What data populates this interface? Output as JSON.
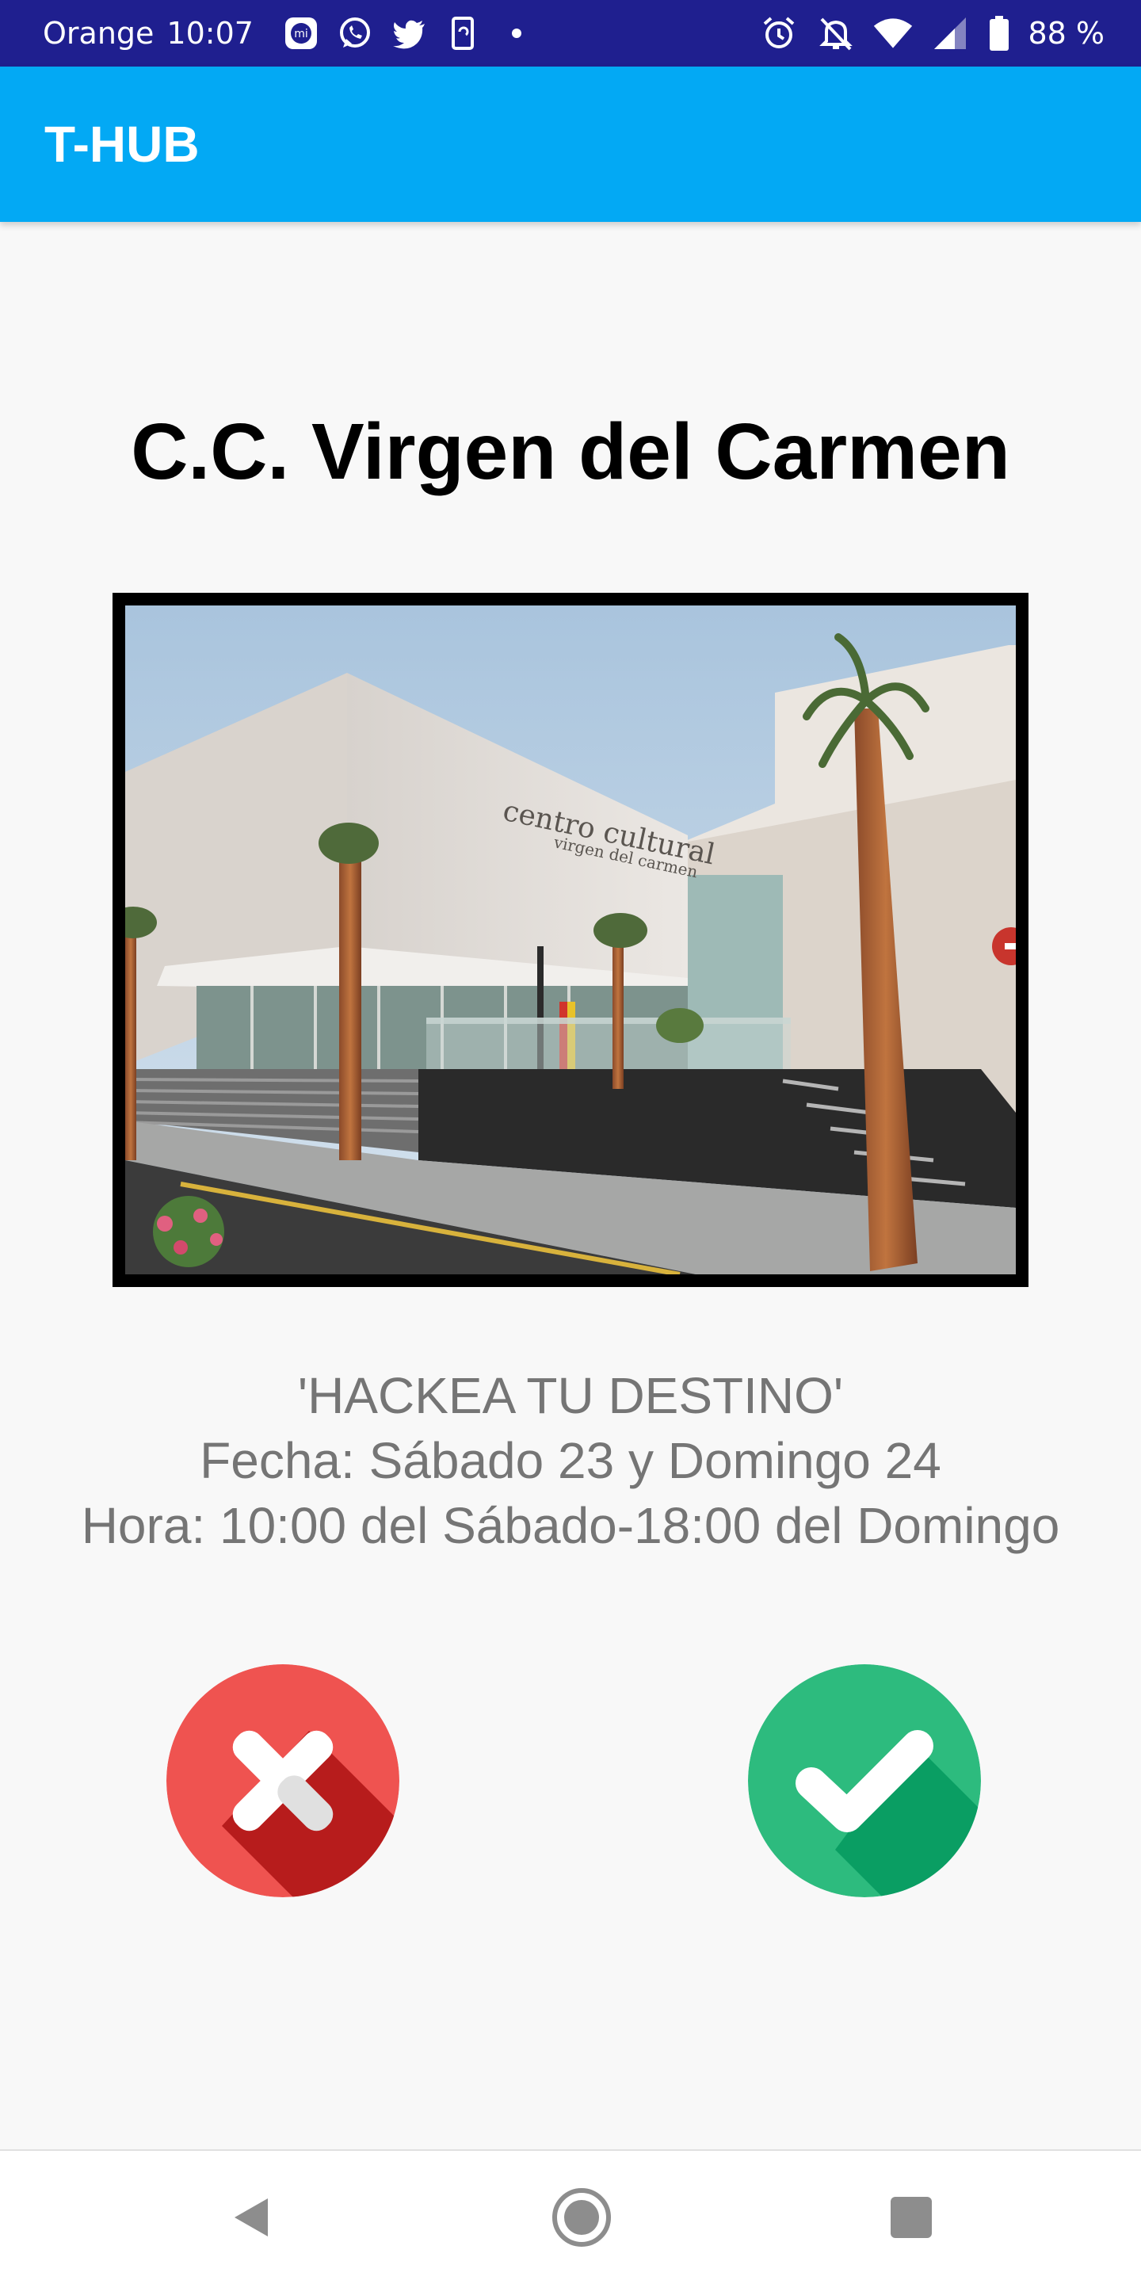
{
  "status_bar": {
    "carrier": "Orange",
    "time": "10:07",
    "battery": "88 %",
    "notification_icons": [
      "mi-icon",
      "whatsapp-icon",
      "twitter-icon",
      "app-icon",
      "dot-icon"
    ],
    "system_icons": [
      "alarm-icon",
      "notifications-off-icon",
      "wifi-icon",
      "signal-icon",
      "battery-icon"
    ]
  },
  "app_bar": {
    "title": "T-HUB",
    "color": "#03a9f4"
  },
  "venue": {
    "name": "C.C. Virgen del Carmen",
    "photo": {
      "sign_line1": "centro cultural",
      "sign_line2": "virgen del carmen"
    }
  },
  "event": {
    "name": "'HACKEA TU DESTINO'",
    "date": "Fecha: Sábado 23 y Domingo 24",
    "time": "Hora: 10:00 del Sábado-18:00 del Domingo"
  },
  "actions": {
    "reject": {
      "icon": "close-icon",
      "color": "#ef5350"
    },
    "accept": {
      "icon": "check-icon",
      "color": "#2dbb7e"
    }
  },
  "nav_bar": {
    "icons": [
      "back-icon",
      "home-icon",
      "recents-icon"
    ]
  }
}
